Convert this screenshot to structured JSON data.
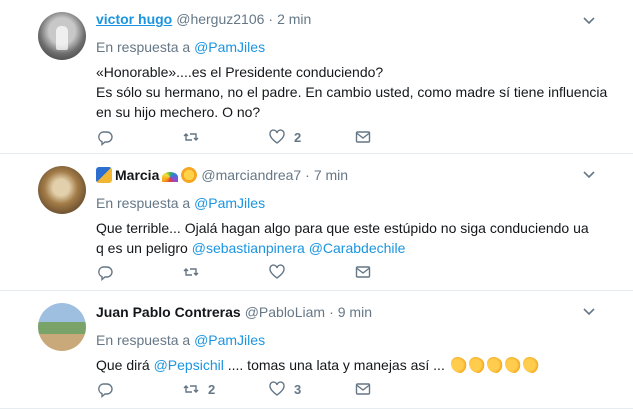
{
  "tweets": [
    {
      "name": "victor hugo",
      "handle": "@herguz2106",
      "time": "2 min",
      "reply_prefix": "En respuesta a ",
      "reply_to": "@PamJiles",
      "text_lines": [
        "«Honorable»....es el Presidente conduciendo?",
        "Es sólo su hermano, no el padre. En cambio usted, como madre sí tiene influencia",
        "en su hijo mechero. O no?"
      ],
      "reply_count": "",
      "retweet_count": "",
      "like_count": "2"
    },
    {
      "name": "Marcia",
      "handle": "@marciandrea7",
      "time": "7 min",
      "reply_prefix": "En respuesta a ",
      "reply_to": "@PamJiles",
      "text_line1": "Que terrible... Ojalá hagan  algo para que este estúpido no siga conduciendo ua",
      "text_line2_prefix": "q es un  peligro ",
      "mention1": "@sebastianpinera",
      "mention2": "@Carabdechile",
      "reply_count": "",
      "retweet_count": "",
      "like_count": ""
    },
    {
      "name": "Juan Pablo Contreras",
      "handle": "@PabloLiam",
      "time": "9 min",
      "reply_prefix": "En respuesta a ",
      "reply_to": "@PamJiles",
      "text_prefix": "Que dirá ",
      "mention": "@Pepsichil",
      "text_suffix": " .... tomas una lata y manejas así ... ",
      "reply_count": "",
      "retweet_count": "2",
      "like_count": "3"
    }
  ],
  "dot": "·",
  "icons": {
    "reply": "reply-icon",
    "retweet": "retweet-icon",
    "like": "heart-icon",
    "dm": "envelope-icon",
    "caret": "chevron-down-icon",
    "clap": "clapping-hands-emoji"
  },
  "colors": {
    "link": "#1b95e0",
    "muted": "#657786",
    "text": "#14171a"
  }
}
